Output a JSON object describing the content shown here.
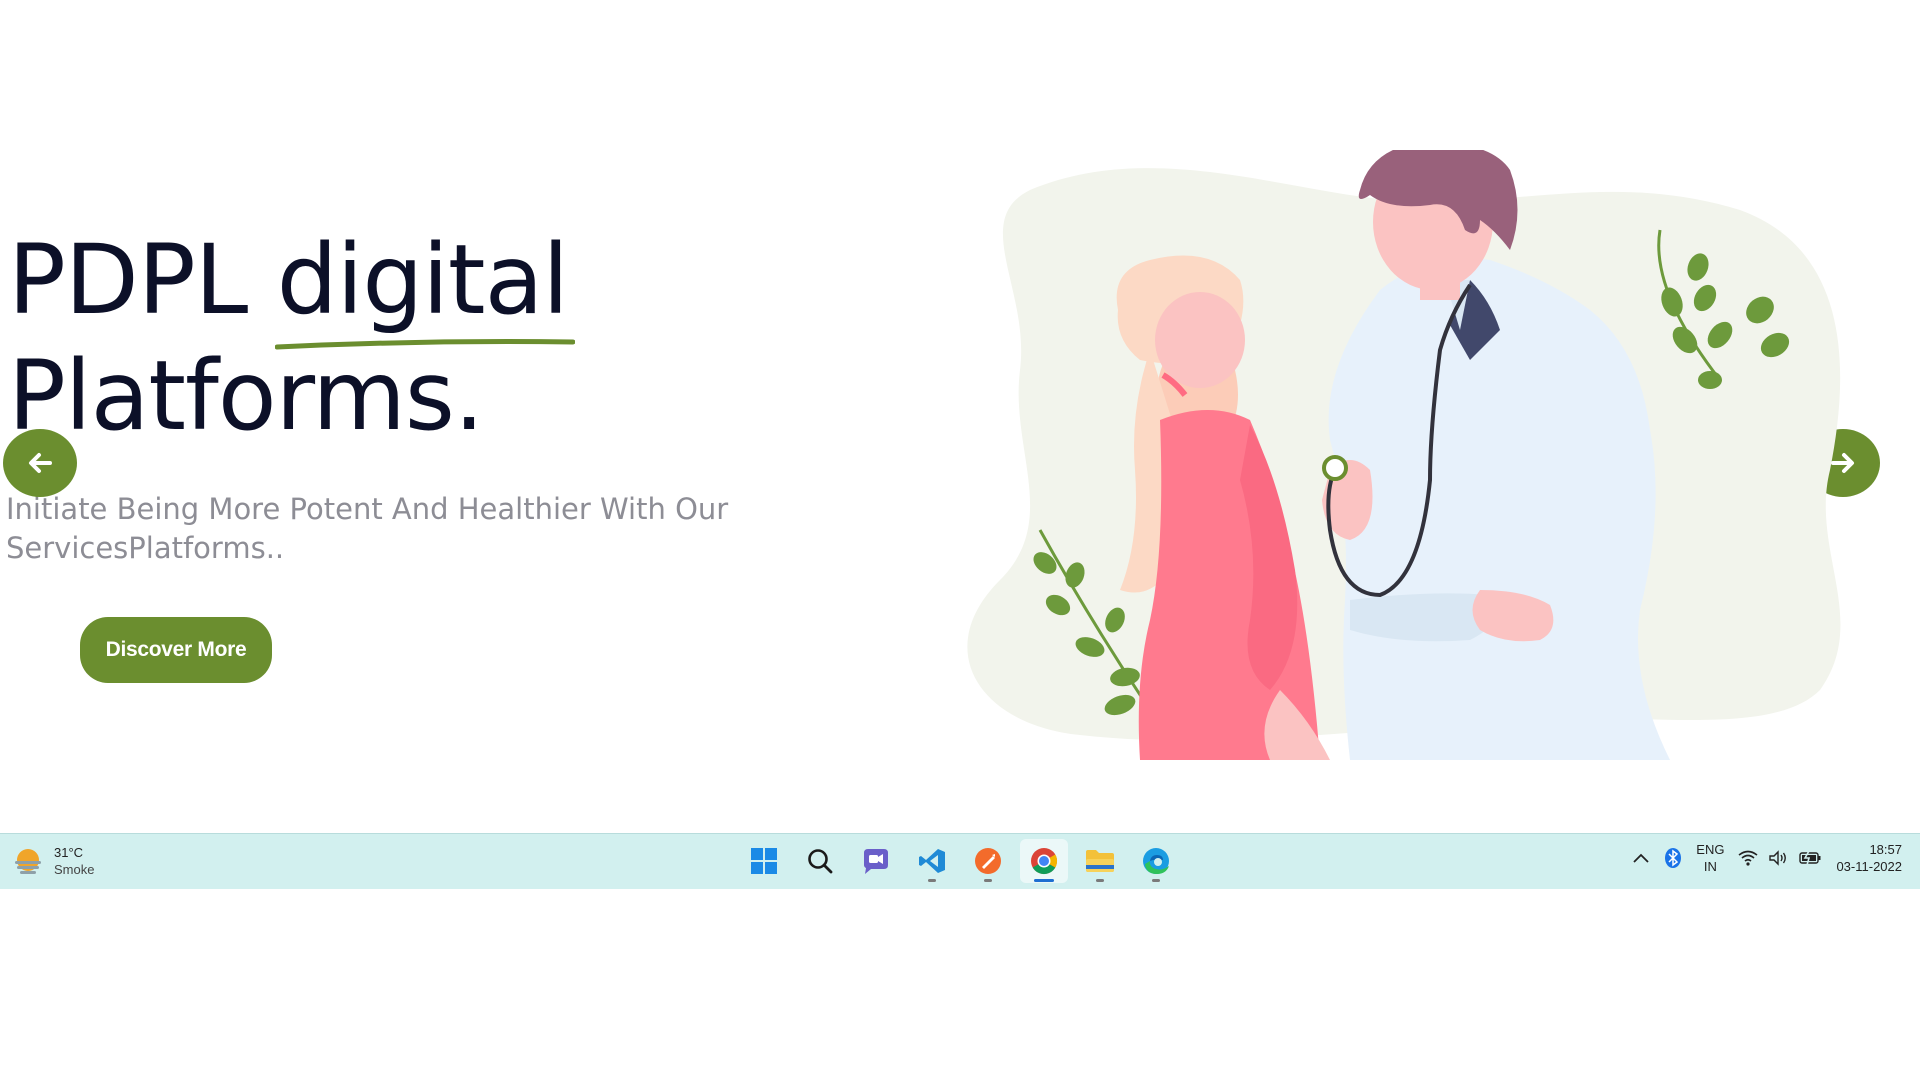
{
  "hero": {
    "title_word1": "PDPL",
    "title_highlight": "digital",
    "title_line2": "Platforms.",
    "subtitle": "Initiate Being More Potent And Healthier With Our ServicesPlatforms..",
    "cta_label": "Discover More",
    "prev_icon": "arrow-left-icon",
    "next_icon": "arrow-right-icon",
    "illustration": "doctor-with-patient-illustration"
  },
  "colors": {
    "accent": "#6b8e2f",
    "title": "#0c1028",
    "subtitle": "#8d8d95",
    "taskbar": "#d2f0ef"
  },
  "taskbar": {
    "weather": {
      "temp": "31°C",
      "condition": "Smoke",
      "icon": "sun-haze-icon"
    },
    "apps": [
      {
        "name": "Start",
        "icon": "windows-start-icon"
      },
      {
        "name": "Search",
        "icon": "search-icon"
      },
      {
        "name": "Chat",
        "icon": "chat-camera-icon"
      },
      {
        "name": "Visual Studio Code",
        "icon": "vscode-icon",
        "running": true
      },
      {
        "name": "Postman",
        "icon": "postman-icon",
        "running": true
      },
      {
        "name": "Google Chrome",
        "icon": "chrome-icon",
        "running": true,
        "active": true
      },
      {
        "name": "File Explorer",
        "icon": "folder-icon",
        "running": true
      },
      {
        "name": "Microsoft Edge",
        "icon": "edge-icon",
        "running": true
      }
    ],
    "tray": {
      "lang_line1": "ENG",
      "lang_line2": "IN",
      "time": "18:57",
      "date": "03-11-2022"
    }
  }
}
